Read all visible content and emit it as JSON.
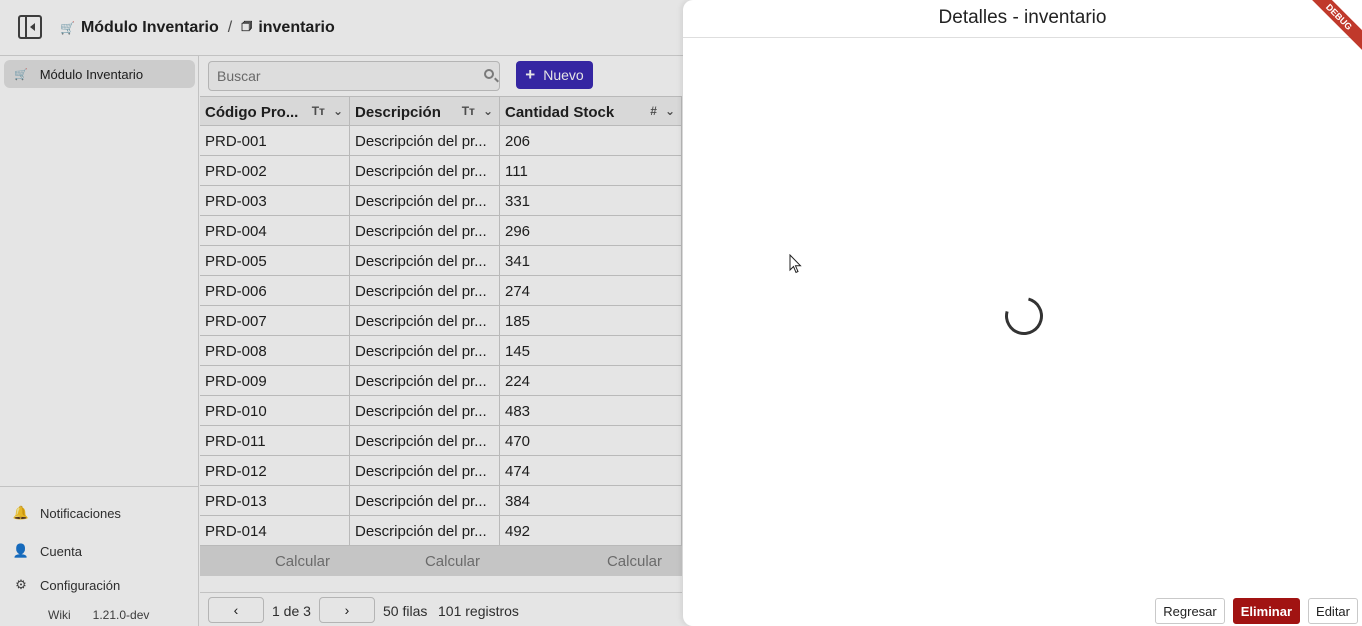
{
  "header": {
    "breadcrumb_module": "Módulo Inventario",
    "breadcrumb_separator": "/",
    "breadcrumb_page": "inventario"
  },
  "sidebar": {
    "active_item": "Módulo Inventario",
    "notifications": "Notificaciones",
    "account": "Cuenta",
    "settings": "Configuración",
    "wiki": "Wiki",
    "version": "1.21.0-dev"
  },
  "toolbar": {
    "search_placeholder": "Buscar",
    "new_label": "Nuevo"
  },
  "table": {
    "columns": [
      "Código Pro...",
      "Descripción",
      "Cantidad Stock"
    ],
    "rows": [
      [
        "PRD-001",
        "Descripción del pr...",
        "206"
      ],
      [
        "PRD-002",
        "Descripción del pr...",
        "111"
      ],
      [
        "PRD-003",
        "Descripción del pr...",
        "331"
      ],
      [
        "PRD-004",
        "Descripción del pr...",
        "296"
      ],
      [
        "PRD-005",
        "Descripción del pr...",
        "341"
      ],
      [
        "PRD-006",
        "Descripción del pr...",
        "274"
      ],
      [
        "PRD-007",
        "Descripción del pr...",
        "185"
      ],
      [
        "PRD-008",
        "Descripción del pr...",
        "145"
      ],
      [
        "PRD-009",
        "Descripción del pr...",
        "224"
      ],
      [
        "PRD-010",
        "Descripción del pr...",
        "483"
      ],
      [
        "PRD-011",
        "Descripción del pr...",
        "470"
      ],
      [
        "PRD-012",
        "Descripción del pr...",
        "474"
      ],
      [
        "PRD-013",
        "Descripción del pr...",
        "384"
      ],
      [
        "PRD-014",
        "Descripción del pr...",
        "492"
      ]
    ],
    "footer": [
      "Calcular",
      "Calcular",
      "Calcular"
    ]
  },
  "pager": {
    "prev": "‹",
    "next": "›",
    "page_text": "1 de 3",
    "rows_per_page": "50 filas",
    "total": "101 registros"
  },
  "drawer": {
    "title": "Detalles - inventario",
    "back_label": "Regresar",
    "delete_label": "Eliminar",
    "edit_label": "Editar",
    "debug_label": "DEBUG"
  },
  "colors": {
    "primary": "#3b2bb5",
    "danger": "#a11312",
    "ribbon": "#c0392b"
  }
}
